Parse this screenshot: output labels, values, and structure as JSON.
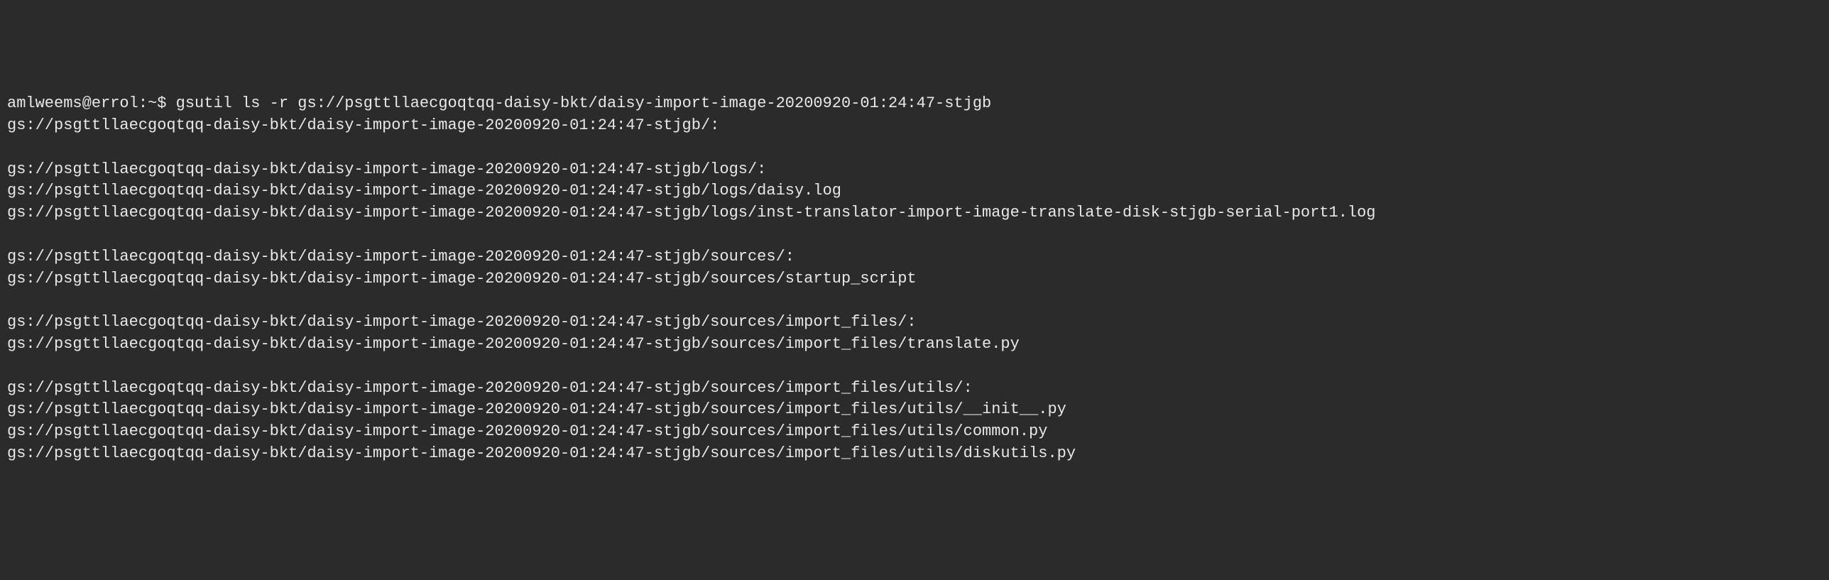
{
  "terminal": {
    "prompt_user_host": "amlweems@errol",
    "prompt_path": "~",
    "prompt_symbol": "$",
    "command": "gsutil ls -r gs://psgttllaecgoqtqq-daisy-bkt/daisy-import-image-20200920-01:24:47-stjgb",
    "lines": [
      "gs://psgttllaecgoqtqq-daisy-bkt/daisy-import-image-20200920-01:24:47-stjgb/:",
      "",
      "gs://psgttllaecgoqtqq-daisy-bkt/daisy-import-image-20200920-01:24:47-stjgb/logs/:",
      "gs://psgttllaecgoqtqq-daisy-bkt/daisy-import-image-20200920-01:24:47-stjgb/logs/daisy.log",
      "gs://psgttllaecgoqtqq-daisy-bkt/daisy-import-image-20200920-01:24:47-stjgb/logs/inst-translator-import-image-translate-disk-stjgb-serial-port1.log",
      "",
      "gs://psgttllaecgoqtqq-daisy-bkt/daisy-import-image-20200920-01:24:47-stjgb/sources/:",
      "gs://psgttllaecgoqtqq-daisy-bkt/daisy-import-image-20200920-01:24:47-stjgb/sources/startup_script",
      "",
      "gs://psgttllaecgoqtqq-daisy-bkt/daisy-import-image-20200920-01:24:47-stjgb/sources/import_files/:",
      "gs://psgttllaecgoqtqq-daisy-bkt/daisy-import-image-20200920-01:24:47-stjgb/sources/import_files/translate.py",
      "",
      "gs://psgttllaecgoqtqq-daisy-bkt/daisy-import-image-20200920-01:24:47-stjgb/sources/import_files/utils/:",
      "gs://psgttllaecgoqtqq-daisy-bkt/daisy-import-image-20200920-01:24:47-stjgb/sources/import_files/utils/__init__.py",
      "gs://psgttllaecgoqtqq-daisy-bkt/daisy-import-image-20200920-01:24:47-stjgb/sources/import_files/utils/common.py",
      "gs://psgttllaecgoqtqq-daisy-bkt/daisy-import-image-20200920-01:24:47-stjgb/sources/import_files/utils/diskutils.py"
    ]
  }
}
